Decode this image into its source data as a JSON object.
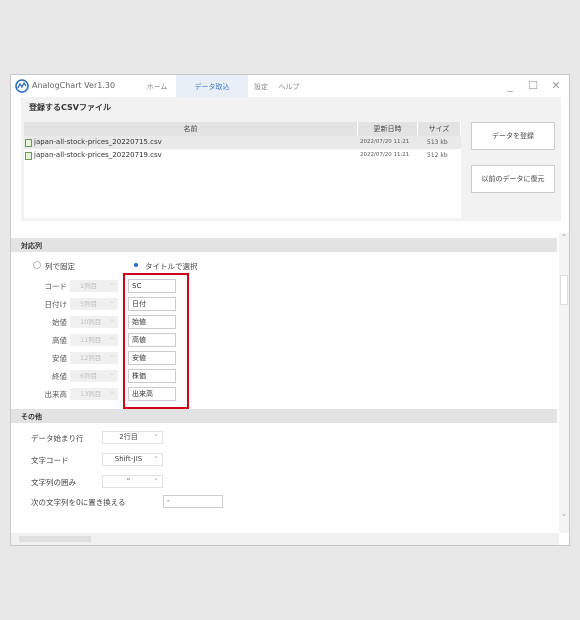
{
  "app": {
    "title": "AnalogChart Ver1.30"
  },
  "menu": [
    {
      "label": "ホーム",
      "active": false
    },
    {
      "label": "データ取込",
      "active": true
    },
    {
      "label": "設定",
      "active": false
    },
    {
      "label": "ヘルプ",
      "active": false
    }
  ],
  "window_controls": {
    "minimize": "_",
    "maximize": "☐",
    "close": "✕"
  },
  "csv_section": {
    "title": "登録するCSVファイル",
    "headers": {
      "name": "名前",
      "updated": "更新日時",
      "size": "サイズ"
    },
    "files": [
      {
        "name": "japan-all-stock-prices_20220715.csv",
        "updated": "2022/07/20 11:21",
        "size": "513 kb"
      },
      {
        "name": "japan-all-stock-prices_20220719.csv",
        "updated": "2022/07/20 11:21",
        "size": "512 kb"
      }
    ],
    "register_button": "データを登録",
    "restore_button": "以前のデータに復元"
  },
  "mapping_section": {
    "title": "対応列",
    "radio_fixed": "列で固定",
    "radio_title": "タイトルで選択",
    "selected_mode": "title",
    "rows": [
      {
        "label": "コード",
        "column": "1列目",
        "value": "SC"
      },
      {
        "label": "日付け",
        "column": "5列目",
        "value": "日付"
      },
      {
        "label": "始値",
        "column": "10列目",
        "value": "始値"
      },
      {
        "label": "高値",
        "column": "11列目",
        "value": "高値"
      },
      {
        "label": "安値",
        "column": "12列目",
        "value": "安値"
      },
      {
        "label": "終値",
        "column": "6列目",
        "value": "株価"
      },
      {
        "label": "出来高",
        "column": "13列目",
        "value": "出来高"
      }
    ]
  },
  "other_section": {
    "title": "その他",
    "data_start_label": "データ始まり行",
    "data_start_value": "2行目",
    "encoding_label": "文字コード",
    "encoding_value": "Shift-JIS",
    "quote_label": "文字列の囲み",
    "quote_value": "\"",
    "replace_label": "次の文字列を0に置き換える",
    "replace_value": "-"
  },
  "colors": {
    "accent": "#3a78c6",
    "highlight": "#d0021b"
  }
}
